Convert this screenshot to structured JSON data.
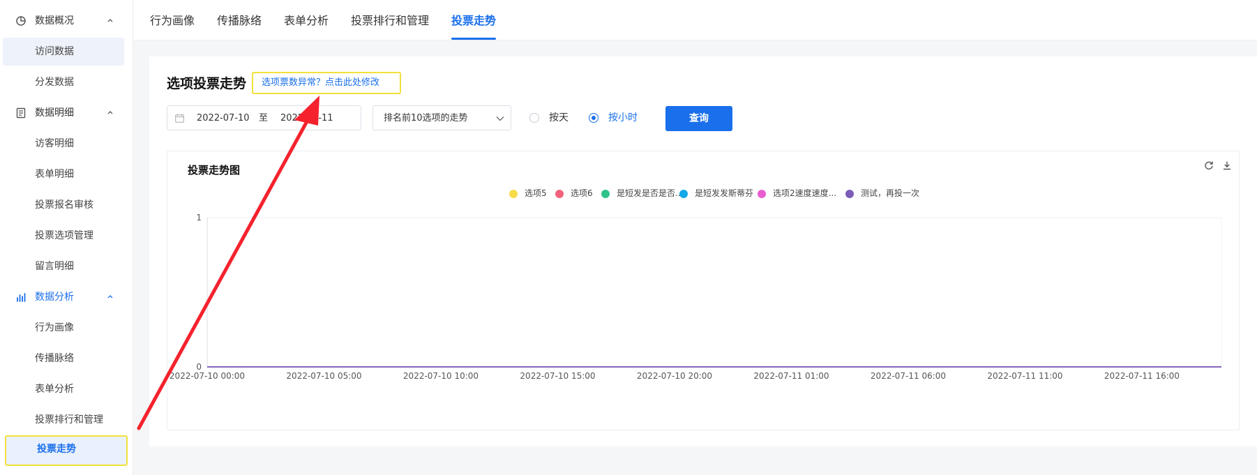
{
  "sidebar": {
    "groups": [
      {
        "label": "数据概况",
        "icon": "pie-chart-icon",
        "items": [
          "访问数据",
          "分发数据"
        ]
      },
      {
        "label": "数据明细",
        "icon": "document-list-icon",
        "items": [
          "访客明细",
          "表单明细",
          "投票报名审核",
          "投票选项管理",
          "留言明细"
        ]
      },
      {
        "label": "数据分析",
        "icon": "bar-chart-icon",
        "items": [
          "行为画像",
          "传播脉络",
          "表单分析",
          "投票排行和管理",
          "投票走势"
        ]
      }
    ]
  },
  "tabs": [
    "行为画像",
    "传播脉络",
    "表单分析",
    "投票排行和管理",
    "投票走势"
  ],
  "active_tab": "投票走势",
  "main": {
    "title": "选项投票走势",
    "fix_link": "选项票数异常？点击此处修改",
    "date_start": "2022-07-10",
    "date_sep": "至",
    "date_end": "2022-07-11",
    "select_value": "排名前10选项的走势",
    "radio_day": "按天",
    "radio_hour": "按小时",
    "radio_selected": "按小时",
    "query_button": "查询"
  },
  "chart_data": {
    "type": "line",
    "title": "投票走势图",
    "x": [
      "2022-07-10 00:00",
      "2022-07-10 05:00",
      "2022-07-10 10:00",
      "2022-07-10 15:00",
      "2022-07-10 20:00",
      "2022-07-11 01:00",
      "2022-07-11 06:00",
      "2022-07-11 11:00",
      "2022-07-11 16:00"
    ],
    "series": [
      {
        "name": "选项5",
        "color": "#f7dc4a",
        "values": [
          0,
          0,
          0,
          0,
          0,
          0,
          0,
          0,
          0
        ]
      },
      {
        "name": "选项6",
        "color": "#f2637b",
        "values": [
          0,
          0,
          0,
          0,
          0,
          0,
          0,
          0,
          0
        ]
      },
      {
        "name": "是短发是否是否...",
        "color": "#2fc28a",
        "values": [
          0,
          0,
          0,
          0,
          0,
          0,
          0,
          0,
          0
        ]
      },
      {
        "name": "是短发发斯蒂芬",
        "color": "#13a8e8",
        "values": [
          0,
          0,
          0,
          0,
          0,
          0,
          0,
          0,
          0
        ]
      },
      {
        "name": "选项2速度速度...",
        "color": "#e85ed0",
        "values": [
          0,
          0,
          0,
          0,
          0,
          0,
          0,
          0,
          0
        ]
      },
      {
        "name": "测试，再投一次",
        "color": "#7b5cb8",
        "values": [
          0,
          0,
          0,
          0,
          0,
          0,
          0,
          0,
          0
        ]
      }
    ],
    "y_ticks": [
      "0",
      "1"
    ],
    "ylim": [
      0,
      1
    ],
    "legend": "top-center",
    "grid": false
  }
}
